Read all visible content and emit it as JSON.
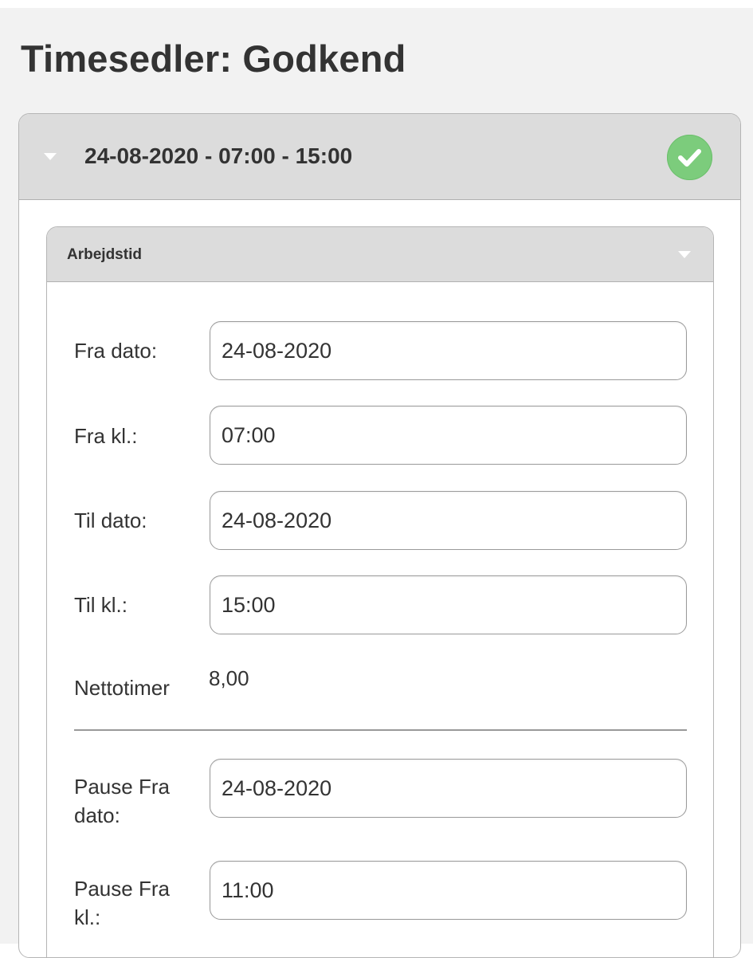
{
  "page": {
    "title": "Timesedler: Godkend"
  },
  "timesheet": {
    "header_title": "24-08-2020 - 07:00 - 15:00",
    "status_icon": "check-circle-icon",
    "status_color": "#7ccc7c"
  },
  "section": {
    "title": "Arbejdstid",
    "fields": {
      "fra_dato": {
        "label": "Fra dato:",
        "value": "24-08-2020"
      },
      "fra_kl": {
        "label": "Fra kl.:",
        "value": "07:00"
      },
      "til_dato": {
        "label": "Til dato:",
        "value": "24-08-2020"
      },
      "til_kl": {
        "label": "Til kl.:",
        "value": "15:00"
      },
      "nettotimer": {
        "label": "Nettotimer",
        "value": "8,00"
      },
      "pause_fra_dato": {
        "label": "Pause Fra dato:",
        "value": "24-08-2020"
      },
      "pause_fra_kl": {
        "label": "Pause Fra kl.:",
        "value": "11:00"
      }
    }
  }
}
